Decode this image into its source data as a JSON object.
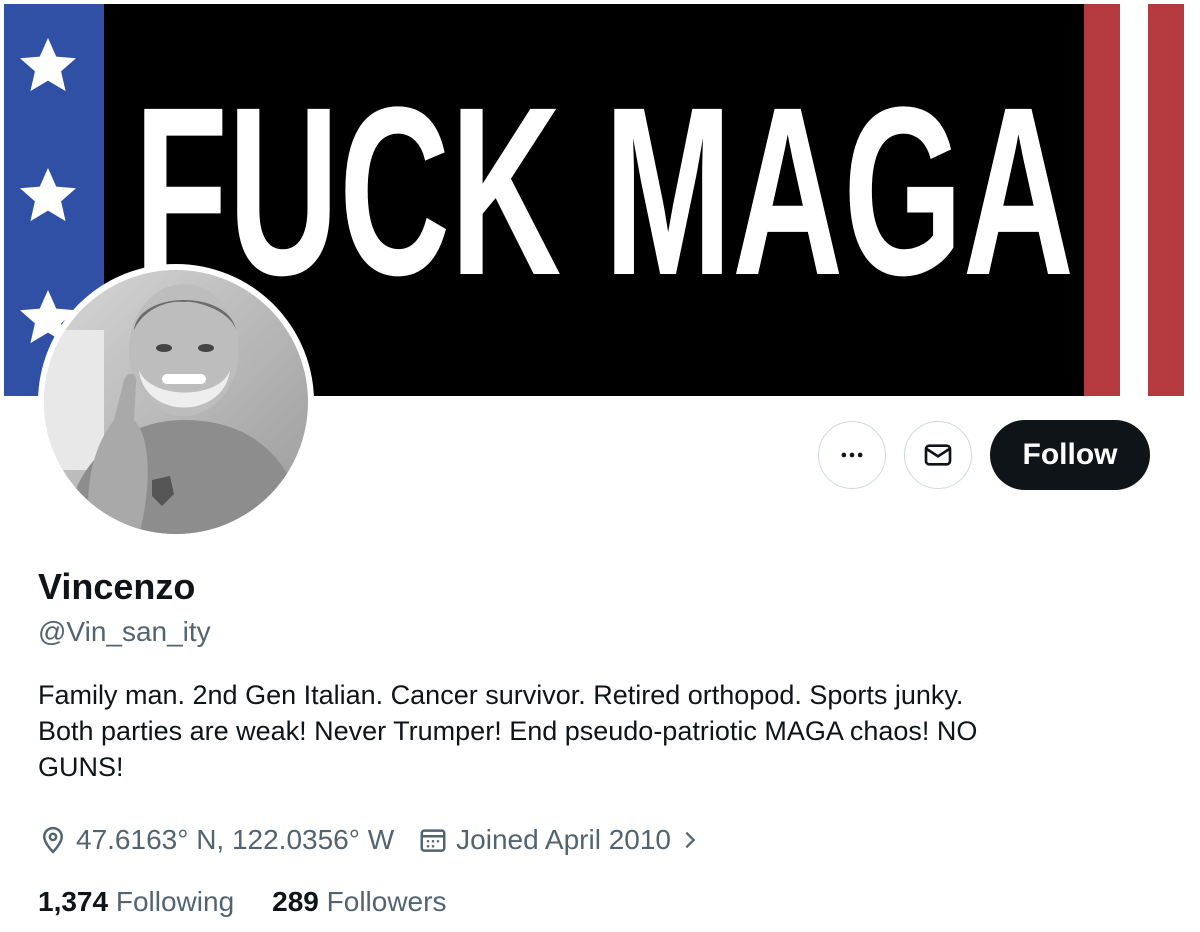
{
  "banner": {
    "text": "FUCK MAGA",
    "colors": {
      "background": "#000000",
      "stars_field": "#3050a5",
      "stripe_red": "#b53a3f",
      "text": "#ffffff"
    }
  },
  "profile": {
    "display_name": "Vincenzo",
    "handle": "@Vin_san_ity",
    "bio_lines": [
      "Family man. 2nd Gen Italian. Cancer survivor. Retired orthopod. Sports junky.",
      "Both parties are weak! Never Trumper! End pseudo-patriotic MAGA chaos! NO",
      "GUNS!"
    ],
    "location": "47.6163° N, 122.0356° W",
    "joined": "Joined April 2010"
  },
  "actions": {
    "more_icon": "more-horizontal-icon",
    "message_icon": "envelope-icon",
    "follow_label": "Follow"
  },
  "stats": {
    "following_count": "1,374",
    "following_label": "Following",
    "followers_count": "289",
    "followers_label": "Followers"
  },
  "colors": {
    "primary_text": "#0f1419",
    "secondary_text": "#536471",
    "border": "#cfd9de"
  }
}
